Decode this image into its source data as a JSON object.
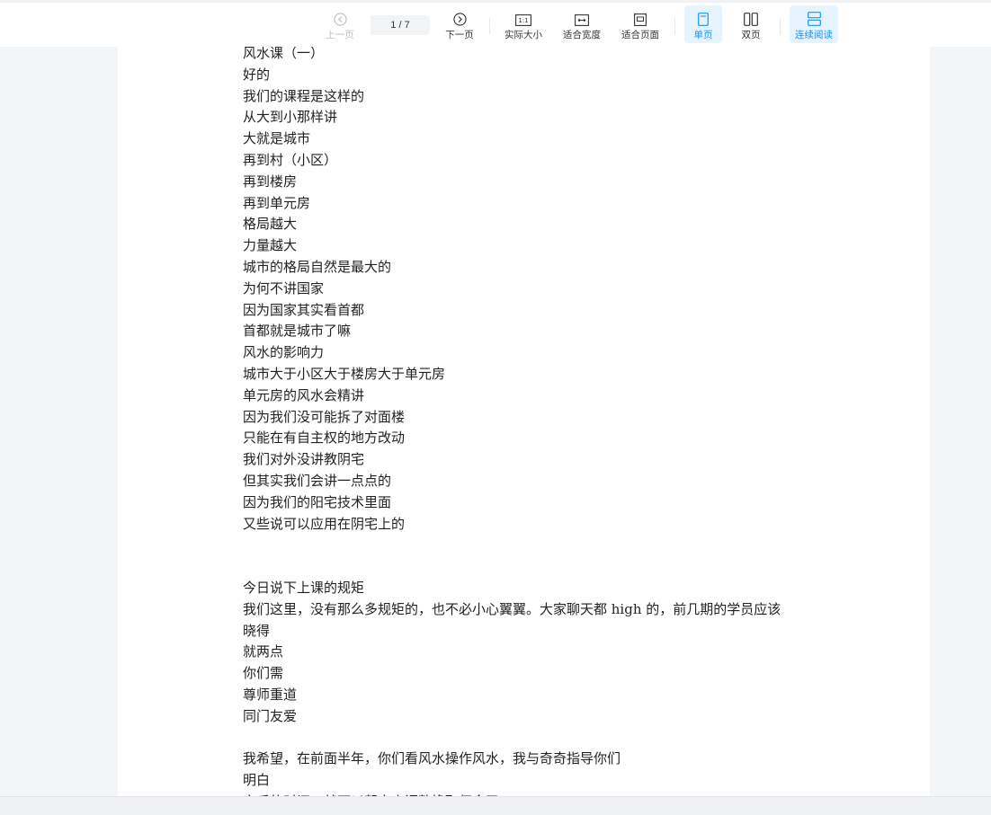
{
  "toolbar": {
    "prev_label": "上一页",
    "page_indicator": "1 / 7",
    "next_label": "下一页",
    "actual_size_label": "实际大小",
    "fit_width_label": "适合宽度",
    "fit_page_label": "适合页面",
    "single_page_label": "单页",
    "double_page_label": "双页",
    "continuous_label": "连续阅读",
    "actual_size_icon_text": "1:1",
    "accent_color": "#1890ff"
  },
  "document": {
    "lines": [
      "风水课（一）",
      "好的",
      "我们的课程是这样的",
      "从大到小那样讲",
      "大就是城市",
      "再到村（小区）",
      "再到楼房",
      "再到单元房",
      "格局越大",
      "力量越大",
      "城市的格局自然是最大的",
      "为何不讲国家",
      "因为国家其实看首都",
      "首都就是城市了嘛",
      "风水的影响力",
      "城市大于小区大于楼房大于单元房",
      "单元房的风水会精讲",
      "因为我们没可能拆了对面楼",
      "只能在有自主权的地方改动",
      "我们对外没讲教阴宅",
      "但其实我们会讲一点点的",
      "因为我们的阳宅技术里面",
      "又些说可以应用在阴宅上的",
      "",
      "",
      "今日说下上课的规矩",
      "我们这里，没有那么多规矩的，也不必小心翼翼。大家聊天都 high 的，前几期的学员应该",
      "晓得",
      "就两点",
      "你们需",
      "尊师重道",
      "同门友爱",
      "",
      "我希望，在前面半年，你们看风水操作风水，我与奇奇指导你们",
      "明白",
      "之后的时间，就可以帮客户调整换取佣金了"
    ]
  }
}
